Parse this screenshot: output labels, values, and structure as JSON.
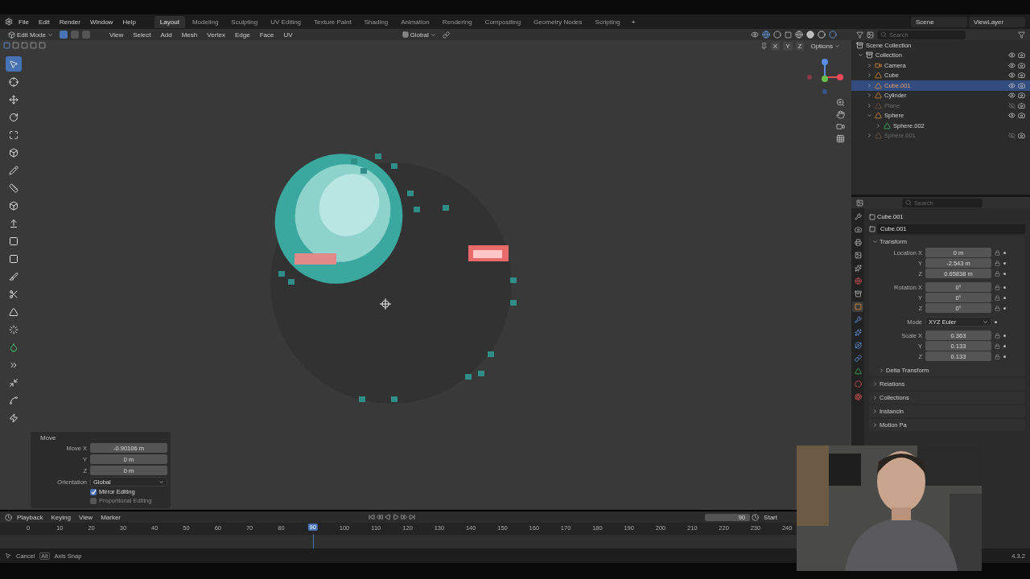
{
  "menu": [
    "File",
    "Edit",
    "Render",
    "Window",
    "Help"
  ],
  "workspaces": [
    {
      "label": "Layout",
      "selected": true
    },
    {
      "label": "Modeling",
      "selected": false
    },
    {
      "label": "Sculpting",
      "selected": false
    },
    {
      "label": "UV Editing",
      "selected": false
    },
    {
      "label": "Texture Paint",
      "selected": false
    },
    {
      "label": "Shading",
      "selected": false
    },
    {
      "label": "Animation",
      "selected": false
    },
    {
      "label": "Rendering",
      "selected": false
    },
    {
      "label": "Compositing",
      "selected": false
    },
    {
      "label": "Geometry Nodes",
      "selected": false
    },
    {
      "label": "Scripting",
      "selected": false
    }
  ],
  "add_tab": "+",
  "scene": "Scene",
  "view_layer": "ViewLayer",
  "viewport_header": {
    "mode": "Edit Mode",
    "select_modes": [
      {
        "selected": true
      },
      {
        "selected": false
      },
      {
        "selected": false
      }
    ],
    "menus": [
      "View",
      "Select",
      "Add",
      "Mesh",
      "Vertex",
      "Edge",
      "Face",
      "UV"
    ],
    "orientation": "Global",
    "axes": [
      "X",
      "Y",
      "Z"
    ],
    "options": "Options"
  },
  "tools": [
    {
      "kind": "select",
      "selected": true
    },
    {
      "kind": "cursor",
      "selected": false
    },
    {
      "kind": "move",
      "selected": false
    },
    {
      "kind": "rotate",
      "selected": false
    },
    {
      "kind": "scale",
      "selected": false
    },
    {
      "kind": "transform",
      "selected": false
    },
    {
      "kind": "annotate",
      "selected": false
    },
    {
      "kind": "measure",
      "selected": false
    },
    {
      "kind": "cube",
      "selected": false
    },
    {
      "kind": "extrude",
      "selected": false
    },
    {
      "kind": "inset",
      "selected": false
    },
    {
      "kind": "bevel",
      "selected": false
    },
    {
      "kind": "loopcut",
      "selected": false
    },
    {
      "kind": "knife",
      "selected": false
    },
    {
      "kind": "polybuild",
      "selected": false
    },
    {
      "kind": "spin",
      "selected": false
    },
    {
      "kind": "smooth",
      "selected": false
    },
    {
      "kind": "slide",
      "selected": false
    },
    {
      "kind": "shrink",
      "selected": false
    },
    {
      "kind": "shear",
      "selected": false
    },
    {
      "kind": "rip",
      "selected": false
    }
  ],
  "move_panel": {
    "title": "Move",
    "fields": [
      {
        "label": "Move X",
        "value": "-0.90106 m"
      },
      {
        "label": "Y",
        "value": "0 m"
      },
      {
        "label": "Z",
        "value": "0 m"
      }
    ],
    "orientation_label": "Orientation",
    "orientation": "Global",
    "options": [
      {
        "label": "Mirror Editing",
        "checked": true
      },
      {
        "label": "Proportional Editing",
        "checked": false
      }
    ]
  },
  "outliner": {
    "search": {
      "placeholder": "Search"
    },
    "root": "Scene Collection",
    "items": [
      {
        "name": "Collection",
        "kind": "collection",
        "expanded": true,
        "selected": false,
        "hidden": false,
        "children": [
          {
            "name": "Camera",
            "kind": "camera",
            "expanded": false,
            "selected": false,
            "hidden": false
          },
          {
            "name": "Cube",
            "kind": "mesh",
            "expanded": false,
            "selected": false,
            "hidden": false
          },
          {
            "name": "Cube.001",
            "kind": "mesh",
            "expanded": false,
            "selected": true,
            "hidden": false
          },
          {
            "name": "Cylinder",
            "kind": "mesh",
            "expanded": false,
            "selected": false,
            "hidden": false
          },
          {
            "name": "Plane",
            "kind": "mesh",
            "expanded": false,
            "selected": false,
            "hidden": true
          },
          {
            "name": "Sphere",
            "kind": "mesh",
            "expanded": true,
            "selected": false,
            "hidden": false,
            "children": [
              {
                "name": "Sphere.002",
                "kind": "meshdata",
                "expanded": false,
                "selected": false,
                "hidden": false
              }
            ]
          },
          {
            "name": "Sphere.001",
            "kind": "mesh",
            "expanded": false,
            "selected": false,
            "hidden": true
          }
        ]
      }
    ]
  },
  "properties": {
    "search": {
      "placeholder": "Search"
    },
    "object_name": "Cube.001",
    "datablock": "Cube.001",
    "tabs": [
      {
        "kind": "tool",
        "selected": false
      },
      {
        "kind": "render",
        "selected": false
      },
      {
        "kind": "output",
        "selected": false
      },
      {
        "kind": "view",
        "selected": false
      },
      {
        "kind": "scene",
        "selected": false
      },
      {
        "kind": "world",
        "selected": false
      },
      {
        "kind": "collection",
        "selected": false
      },
      {
        "kind": "object",
        "selected": true
      },
      {
        "kind": "modifier",
        "selected": false
      },
      {
        "kind": "particles",
        "selected": false
      },
      {
        "kind": "physics",
        "selected": false
      },
      {
        "kind": "constraint",
        "selected": false
      },
      {
        "kind": "data",
        "selected": false
      },
      {
        "kind": "material",
        "selected": false
      },
      {
        "kind": "texture",
        "selected": false
      }
    ],
    "transform": {
      "title": "Transform",
      "groups": [
        {
          "rows": [
            {
              "label": "Location X",
              "value": "0 m",
              "kind": "number"
            },
            {
              "label": "Y",
              "value": "-2.543 m",
              "kind": "number"
            },
            {
              "label": "Z",
              "value": "0.65838 m",
              "kind": "number"
            }
          ]
        },
        {
          "rows": [
            {
              "label": "Rotation X",
              "value": "0°",
              "kind": "number"
            },
            {
              "label": "Y",
              "value": "0°",
              "kind": "number"
            },
            {
              "label": "Z",
              "value": "0°",
              "kind": "number"
            }
          ]
        },
        {
          "rows": [
            {
              "label": "Mode",
              "value": "XYZ Euler",
              "kind": "dropdown"
            }
          ]
        },
        {
          "rows": [
            {
              "label": "Scale X",
              "value": "0.363",
              "kind": "number"
            },
            {
              "label": "Y",
              "value": "0.133",
              "kind": "number"
            },
            {
              "label": "Z",
              "value": "0.133",
              "kind": "number"
            }
          ]
        }
      ],
      "subpanel": "Delta Transform"
    },
    "panels": [
      "Relations",
      "Collections",
      "Instancin",
      "Motion Pa"
    ]
  },
  "timeline": {
    "menus": [
      "Playback",
      "Keying",
      "View",
      "Marker"
    ],
    "frame": "90",
    "start_label": "Start",
    "ticks": [
      "0",
      "10",
      "20",
      "30",
      "40",
      "50",
      "60",
      "70",
      "80",
      "100",
      "110",
      "120",
      "130",
      "140",
      "150",
      "160",
      "170",
      "180",
      "190",
      "200",
      "210",
      "220",
      "230",
      "240"
    ],
    "playhead": "90"
  },
  "status_bar": {
    "items": [
      {
        "kind": "mouse",
        "label": "Cancel"
      },
      {
        "kind": "key",
        "key": "Alt",
        "label": "Axis Snap"
      }
    ],
    "version": "4.3.2"
  }
}
